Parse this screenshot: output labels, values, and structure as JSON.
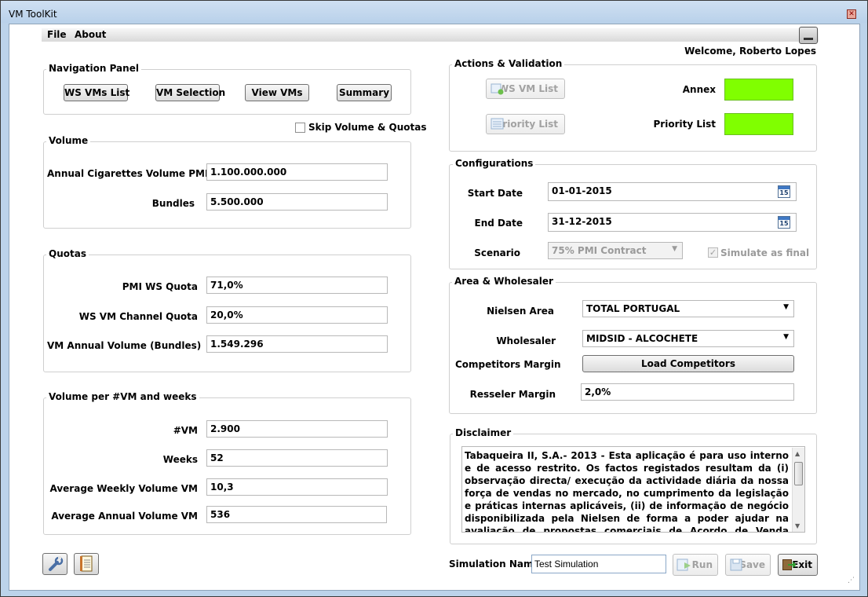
{
  "window": {
    "title": "VM ToolKit"
  },
  "menu": {
    "file": "File",
    "about": "About"
  },
  "welcome": "Welcome, Roberto Lopes",
  "navigation": {
    "title": "Navigation Panel",
    "buttons": [
      "WS VMs List",
      "VM Selection",
      "View VMs",
      "Summary"
    ]
  },
  "skip": {
    "label": "Skip Volume & Quotas",
    "checked": false
  },
  "volume": {
    "title": "Volume",
    "annual_label": "Annual Cigarettes Volume PMI",
    "annual_value": "1.100.000.000",
    "bundles_label": "Bundles",
    "bundles_value": "5.500.000"
  },
  "quotas": {
    "title": "Quotas",
    "pmi_ws_label": "PMI WS Quota",
    "pmi_ws_value": "71,0%",
    "ws_vm_label": "WS VM Channel Quota",
    "ws_vm_value": "20,0%",
    "vm_annual_label": "VM Annual Volume (Bundles)",
    "vm_annual_value": "1.549.296"
  },
  "per_vm": {
    "title": "Volume per #VM and weeks",
    "vm_label": "#VM",
    "vm_value": "2.900",
    "weeks_label": "Weeks",
    "weeks_value": "52",
    "avg_weekly_label": "Average Weekly Volume VM",
    "avg_weekly_value": "10,3",
    "avg_annual_label": "Average Annual Volume VM",
    "avg_annual_value": "536"
  },
  "actions": {
    "title": "Actions & Validation",
    "ws_vm_list": "WS VM List",
    "priority_list_btn": "Priority List",
    "annex_label": "Annex",
    "priority_list_label": "Priority List",
    "indicator_color": "#80ff00"
  },
  "config": {
    "title": "Configurations",
    "start_label": "Start Date",
    "start_value": "01-01-2015",
    "end_label": "End Date",
    "end_value": "31-12-2015",
    "calendar_day": "15",
    "scenario_label": "Scenario",
    "scenario_value": "75% PMI Contract",
    "simulate_label": "Simulate as final",
    "simulate_checked": true
  },
  "area": {
    "title": "Area & Wholesaler",
    "nielsen_label": "Nielsen Area",
    "nielsen_value": "TOTAL PORTUGAL",
    "wholesaler_label": "Wholesaler",
    "wholesaler_value": "MIDSID - ALCOCHETE",
    "competitors_label": "Competitors Margin",
    "load_competitors": "Load Competitors",
    "resseler_label": "Resseler Margin",
    "resseler_value": "2,0%"
  },
  "disclaimer": {
    "title": "Disclaimer",
    "text": "Tabaqueira II, S.A.- 2013 - Esta aplicação é para uso interno e de acesso restrito. Os factos registados resultam da (i) observação directa/ execução da actividade diária da nossa força de vendas no mercado, no cumprimento da legislação e práticas internas aplicáveis, (ii) de informação de negócio disponibilizada pela Nielsen de forma a poder ajudar na avaliação de propostas comerciais de Acordo de Venda Automática de Cigarros a serem apresentadas aos Clientes Grossistas da"
  },
  "bottom": {
    "sim_name_label": "Simulation Name:",
    "sim_name_value": "Test Simulation",
    "run": "Run",
    "save": "Save",
    "exit": "Exit"
  }
}
